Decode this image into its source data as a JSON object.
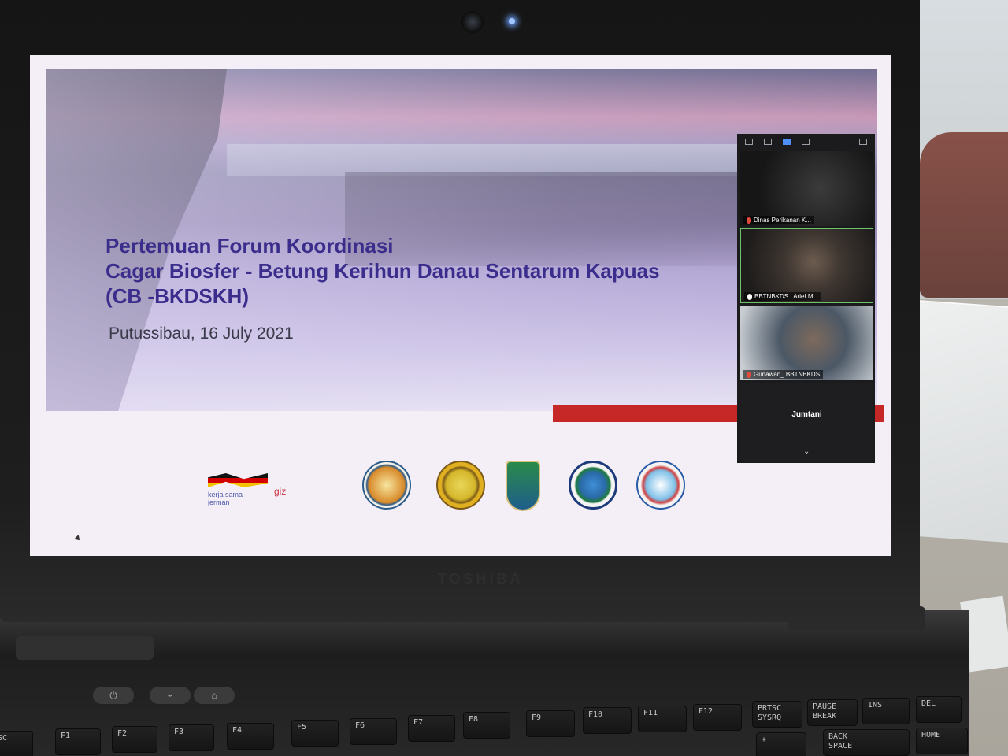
{
  "slide": {
    "title_line1": "Pertemuan Forum Koordinasi",
    "title_line2": "Cagar Biosfer - Betung Kerihun Danau Sentarum Kapuas",
    "title_line3": "(CB -BKDSKH)",
    "subtitle": "Putussibau, 16 July 2021",
    "logos": {
      "giz_text1": "kerja sama",
      "giz_text2": "jerman",
      "giz_label": "giz"
    }
  },
  "zoom": {
    "participants": [
      "Dinas Perikanan K...",
      "BBTNBKDS | Arief M...",
      "Gunawan_ BBTNBKDS",
      "Jumtani"
    ],
    "expand_icon": "chevron-down-icon"
  },
  "laptop": {
    "brand": "TOSHIBA"
  },
  "keyboard": {
    "keys": [
      "SC",
      "F1",
      "F2",
      "F3",
      "F4",
      "F5",
      "F6",
      "F7",
      "F8",
      "F9",
      "F10",
      "F11",
      "F12",
      "PRTSC\nSYSRQ",
      "PAUSE\nBREAK",
      "INS",
      "DEL",
      "+",
      "BACK\nSPACE",
      "HOME"
    ]
  }
}
